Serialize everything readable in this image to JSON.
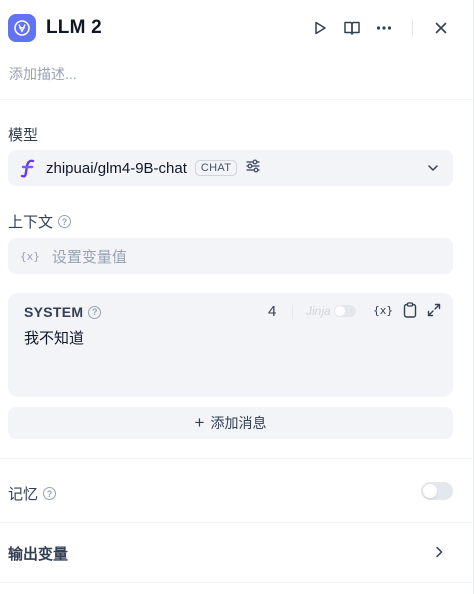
{
  "header": {
    "title": "LLM 2",
    "description_placeholder": "添加描述..."
  },
  "model_section": {
    "label": "模型",
    "model_name": "zhipuai/glm4-9B-chat",
    "mode_badge": "CHAT"
  },
  "context_section": {
    "label": "上下文",
    "placeholder": "设置变量值",
    "var_icon": "{x}"
  },
  "system_prompt": {
    "role_label": "SYSTEM",
    "char_count": "4",
    "jinja_label": "Jinja",
    "var_icon": "{x}",
    "text": "我不知道"
  },
  "add_message": {
    "plus": "+",
    "label": "添加消息"
  },
  "memory": {
    "label": "记忆",
    "enabled": false
  },
  "output": {
    "label": "输出变量"
  },
  "colors": {
    "accent": "#6172f3",
    "field_bg": "#f2f4f7",
    "muted_text": "#98a2b3"
  }
}
